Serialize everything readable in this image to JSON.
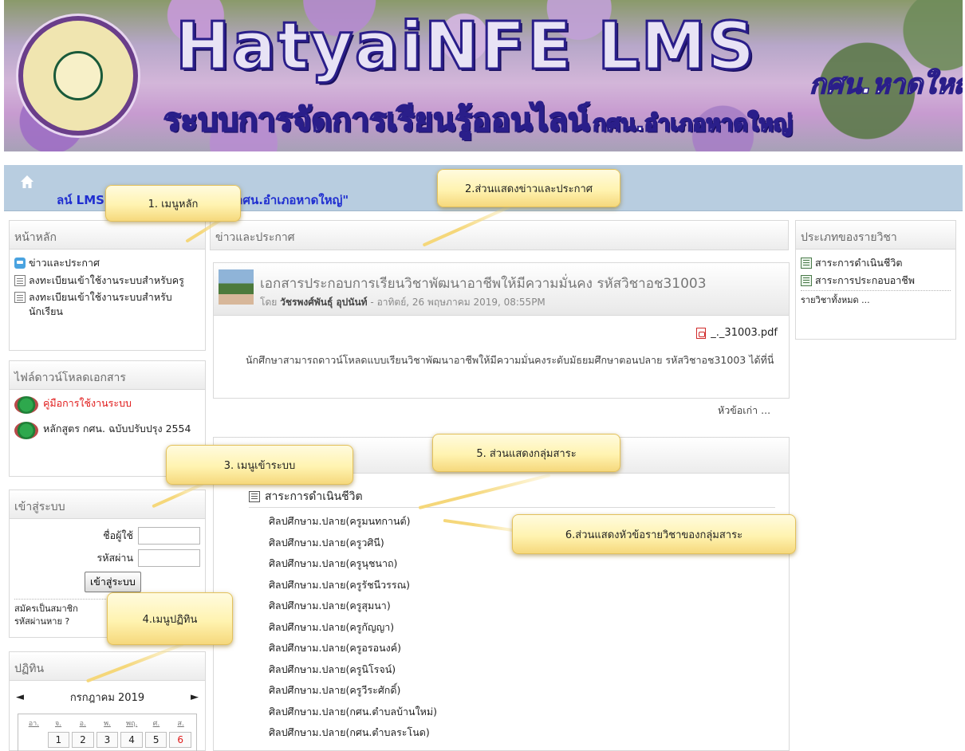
{
  "banner": {
    "title_main": "HatyaiNFE LMS",
    "title_tag": "กศน.หาดใหญ่",
    "subtitle": "ระบบการจัดการเรียนรู้ออนไลน์",
    "subtitle_small": "กศน.อำเภอหาดใหญ่"
  },
  "navbar": {
    "breadcrumb_left": "ลน์ LMS",
    "breadcrumb_right": "ลาย`กศน.อำเภอหาดใหญ่\""
  },
  "left": {
    "main_menu": {
      "title": "หน้าหลัก",
      "items": [
        {
          "label": "ข่าวและประกาศ",
          "icon": "news-icon"
        },
        {
          "label": "ลงทะเบียนเข้าใช้งานระบบสำหรับครู",
          "icon": "page-icon"
        },
        {
          "label": "ลงทะเบียนเข้าใช้งานระบบสำหรับนักเรียน",
          "icon": "page-icon"
        }
      ]
    },
    "downloads": {
      "title": "ไฟล์ดาวน์โหลดเอกสาร",
      "items": [
        {
          "label": "คู่มือการใช้งานระบบ",
          "color": "#e01b1b"
        },
        {
          "label": "หลักสูตร กศน. ฉบับปรับปรุง 2554",
          "color": "#222222"
        }
      ]
    },
    "login": {
      "title": "เข้าสู่ระบบ",
      "username_label": "ชื่อผู้ใช้",
      "password_label": "รหัสผ่าน",
      "username_value": "",
      "password_value": "",
      "button": "เข้าสู่ระบบ",
      "signup": "สมัครเป็นสมาชิก",
      "forgot": "รหัสผ่านหาย ?"
    },
    "calendar": {
      "title": "ปฏิทิน",
      "month": "กรกฎาคม 2019",
      "prev": "◄",
      "next": "►",
      "dow": [
        "อา.",
        "จ.",
        "อ.",
        "พ.",
        "พฤ.",
        "ศ.",
        "ส."
      ],
      "days": [
        "1",
        "2",
        "3",
        "4",
        "5",
        "6"
      ]
    }
  },
  "center": {
    "news": {
      "title": "ข่าวและประกาศ",
      "post_title": "เอกสารประกอบการเรียนวิชาพัฒนาอาชีพให้มีความมั่นคง รหัสวิชาอช31003",
      "post_by": "โดย",
      "post_author": "วัชรพงศ์พันธุ์ อุปนันท์",
      "post_date": "- อาทิตย์, 26 พฤษภาคม 2019, 08:55PM",
      "attachment": "_._31003.pdf",
      "body": "นักศึกษาสามารถดาวน์โหลดแบบเรียนวิชาพัฒนาอาชีพให้มีความมั่นคงระดับมัธยมศึกษาตอนปลาย รหัสวิชาอช31003 ได้ที่นี่",
      "older": "หัวข้อเก่า ..."
    },
    "categories": {
      "category": "สาระการดำเนินชีวิต",
      "courses": [
        "ศิลปศึกษาม.ปลาย(ครูมนทกานต์)",
        "ศิลปศึกษาม.ปลาย(ครูวศินี)",
        "ศิลปศึกษาม.ปลาย(ครูนุชนาถ)",
        "ศิลปศึกษาม.ปลาย(ครูรัชนีวรรณ)",
        "ศิลปศึกษาม.ปลาย(ครูสุมนา)",
        "ศิลปศึกษาม.ปลาย(ครูกัญญา)",
        "ศิลปศึกษาม.ปลาย(ครูอรอนงค์)",
        "ศิลปศึกษาม.ปลาย(ครูนิโรจน์)",
        "ศิลปศึกษาม.ปลาย(ครูวีระศักดิ์)",
        "ศิลปศึกษาม.ปลาย(กศน.ตำบลบ้านใหม่)",
        "ศิลปศึกษาม.ปลาย(กศน.ตำบลระโนด)"
      ]
    }
  },
  "right": {
    "course_types": {
      "title": "ประเภทของรายวิชา",
      "items": [
        "สาระการดำเนินชีวิต",
        "สาระการประกอบอาชีพ"
      ],
      "all": "รายวิชาทั้งหมด ..."
    }
  },
  "callouts": {
    "c1": "1. เมนูหลัก",
    "c2": "2.ส่วนแสดงข่าวและประกาศ",
    "c3": "3. เมนูเข้าระบบ",
    "c4": "4.เมนูปฏิทิน",
    "c5": "5. ส่วนแสดงกลุ่มสาระ",
    "c6": "6.ส่วนแสดงหัวข้อรายวิชาของกลุ่มสาระ"
  }
}
